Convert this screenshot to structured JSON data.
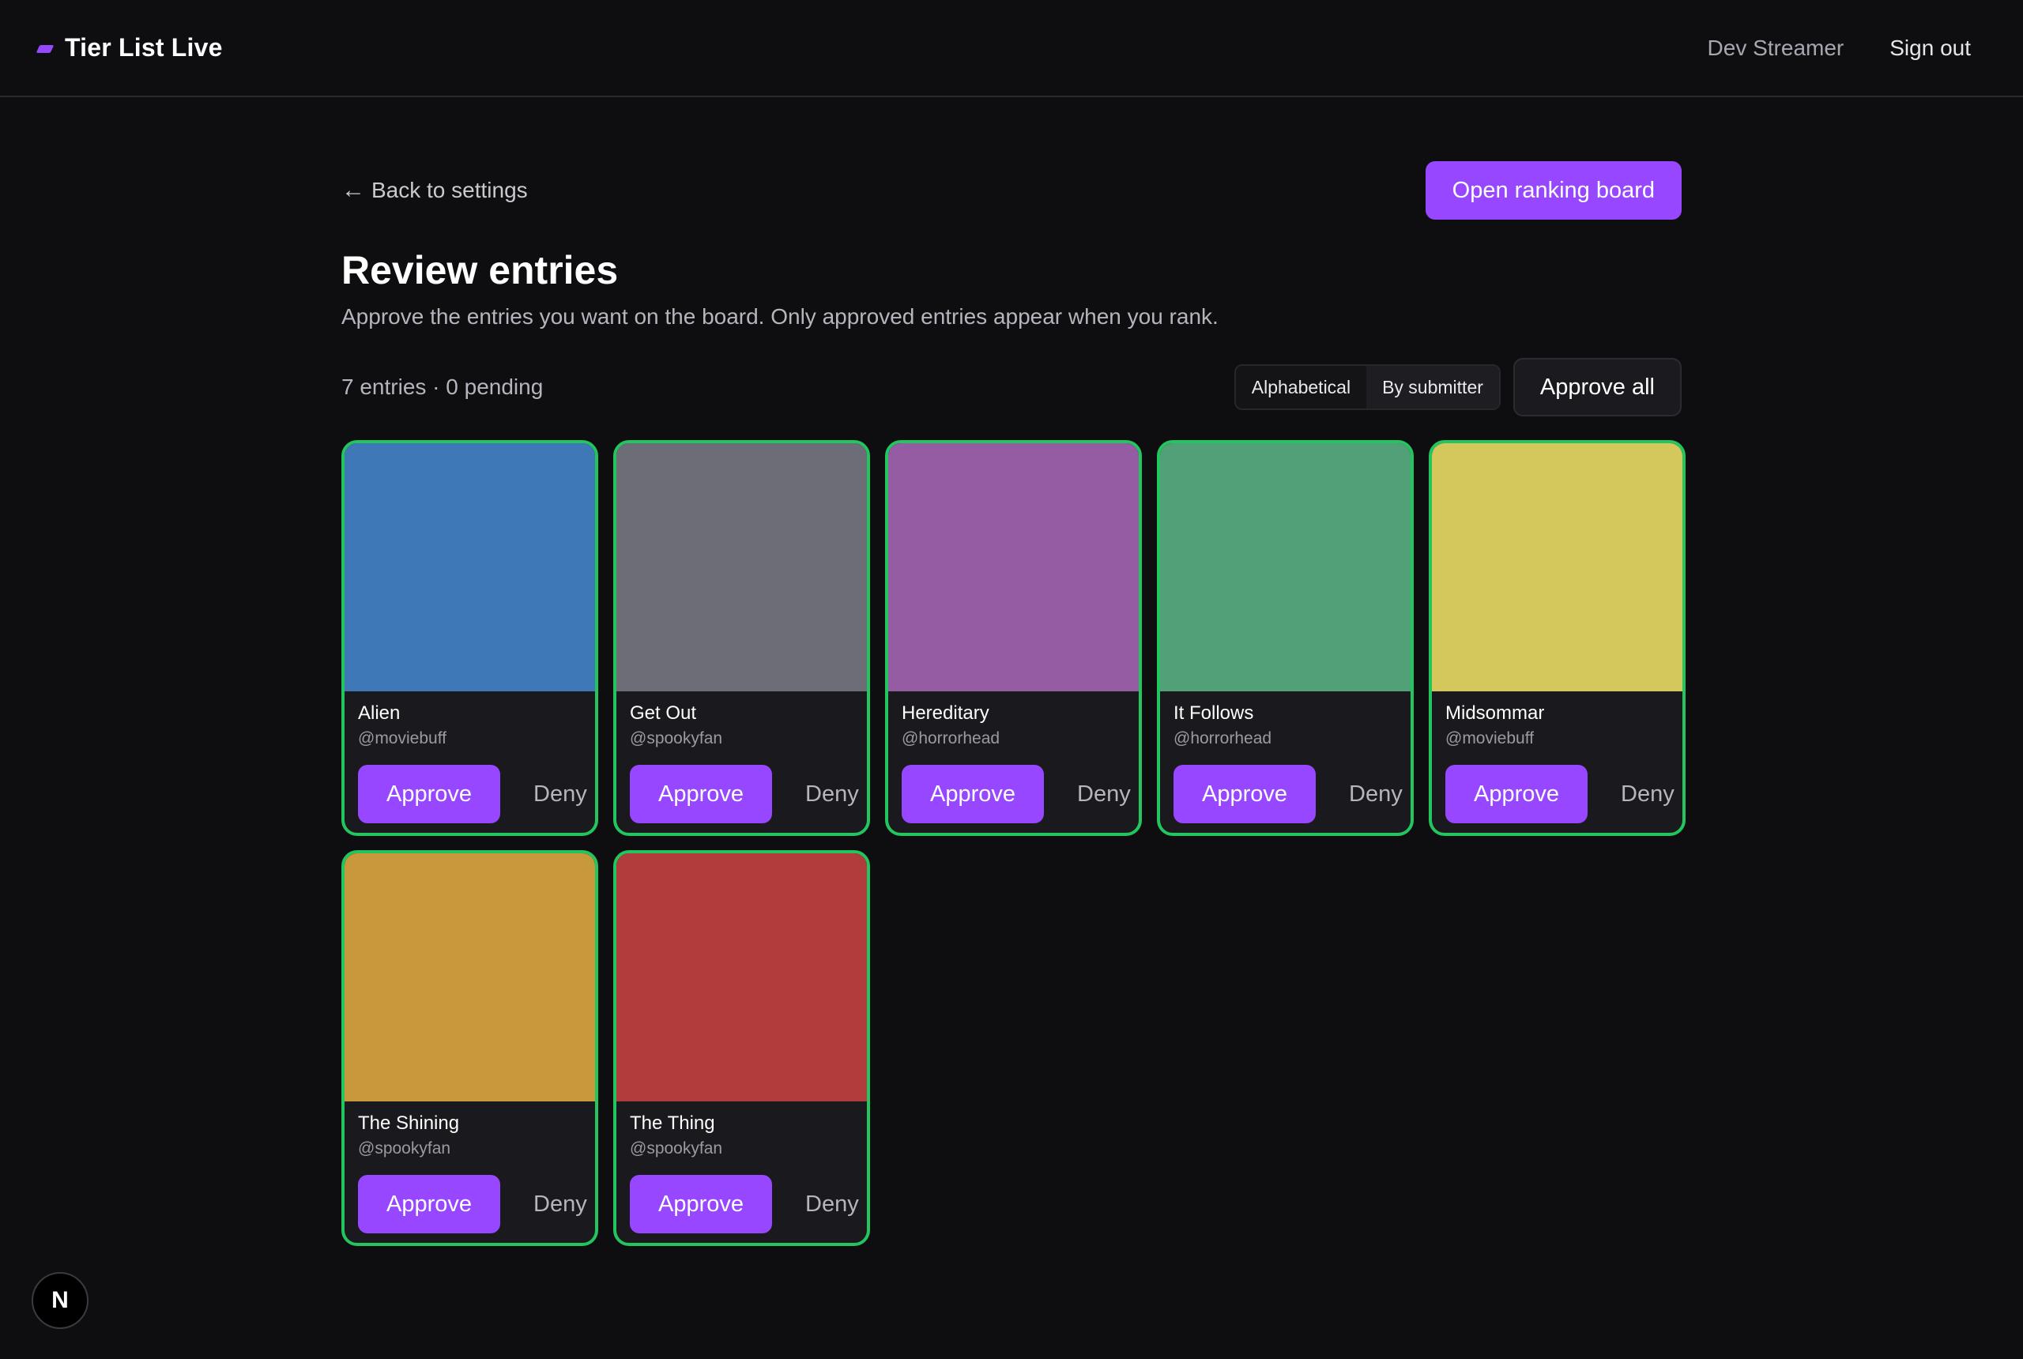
{
  "header": {
    "app_title": "Tier List Live",
    "user_name": "Dev Streamer",
    "sign_out_label": "Sign out"
  },
  "nav": {
    "back_label": "Back to settings",
    "back_arrow": "←",
    "open_board_label": "Open ranking board"
  },
  "page": {
    "title": "Review entries",
    "description": "Approve the entries you want on the board. Only approved entries appear when you rank.",
    "count_text": "7 entries · 0 pending"
  },
  "sort": {
    "options": [
      "Alphabetical",
      "By submitter"
    ],
    "selected": "Alphabetical"
  },
  "approve_all_label": "Approve all",
  "colors": {
    "accent": "#9747ff",
    "approved_border": "#22c55e"
  },
  "entries": [
    {
      "title": "Alien",
      "submitter": "@moviebuff",
      "color": "#3f78b6",
      "approve_label": "Approve",
      "deny_label": "Deny"
    },
    {
      "title": "Get Out",
      "submitter": "@spookyfan",
      "color": "#6d6d78",
      "approve_label": "Approve",
      "deny_label": "Deny"
    },
    {
      "title": "Hereditary",
      "submitter": "@horrorhead",
      "color": "#955ba3",
      "approve_label": "Approve",
      "deny_label": "Deny"
    },
    {
      "title": "It Follows",
      "submitter": "@horrorhead",
      "color": "#51a078",
      "approve_label": "Approve",
      "deny_label": "Deny"
    },
    {
      "title": "Midsommar",
      "submitter": "@moviebuff",
      "color": "#d4c85c",
      "approve_label": "Approve",
      "deny_label": "Deny"
    },
    {
      "title": "The Shining",
      "submitter": "@spookyfan",
      "color": "#c8983c",
      "approve_label": "Approve",
      "deny_label": "Deny"
    },
    {
      "title": "The Thing",
      "submitter": "@spookyfan",
      "color": "#b13c3c",
      "approve_label": "Approve",
      "deny_label": "Deny"
    }
  ],
  "dev_badge": "N"
}
